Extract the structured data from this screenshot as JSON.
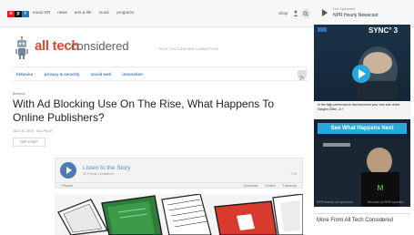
{
  "topbar": {
    "logo_letters": [
      "n",
      "p",
      "r"
    ],
    "nav_items": [
      "music ER",
      "news",
      "arts & life",
      "music",
      "programs"
    ],
    "shop_label": "Shop",
    "stream_label": "Live Sponsored",
    "stream_title": "NPR Hourly Newscast"
  },
  "brand": {
    "name_part1": "all tech",
    "name_part2": "considered",
    "tagline": "TECH, CULTURE AND CONNECTION"
  },
  "section_nav": {
    "items": [
      "behavior",
      "privacy & security",
      "social web",
      "innovation"
    ]
  },
  "article": {
    "kicker": "Behavior",
    "headline": "With Ad Blocking Use On The Rise, What Happens To Online Publishers?",
    "dateline": "JULY 20, 2015 · 6:11 PM ET",
    "byline": "NPR STAFF"
  },
  "player": {
    "listen_label": "Listen to the Story",
    "sub_label": "All Things Considered",
    "duration": "7:29",
    "playlist_label": "+ Playlist",
    "actions": [
      "↓ Download",
      "Embed",
      "Transcript"
    ]
  },
  "ad": {
    "brand": "SYNC° 3",
    "promo_text": "In the high performance fast becomes your new star driver Vaughn Gittin, Jr.?",
    "cta": "See What Happens Next",
    "sponsor_left": "NPR thanks our sponsors",
    "sponsor_right": "Become an NPR sponsor"
  },
  "sidebar": {
    "more_from": "More From All Tech Considered"
  },
  "colors": {
    "brand_red": "#e1492d",
    "link_blue": "#4a7bb5",
    "ad_blue": "#29a8e0"
  }
}
